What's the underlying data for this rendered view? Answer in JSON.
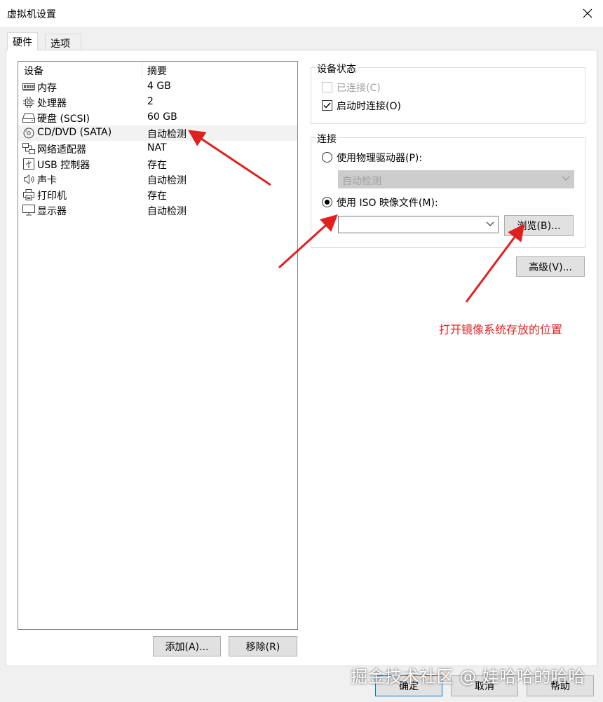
{
  "window": {
    "title": "虚拟机设置",
    "close_icon": "close-icon"
  },
  "tabs": [
    {
      "label": "硬件",
      "active": true
    },
    {
      "label": "选项",
      "active": false
    }
  ],
  "device_list": {
    "header_device": "设备",
    "header_summary": "摘要",
    "rows": [
      {
        "name": "内存",
        "summary": "4 GB",
        "icon": "memory-icon"
      },
      {
        "name": "处理器",
        "summary": "2",
        "icon": "processor-icon"
      },
      {
        "name": "硬盘 (SCSI)",
        "summary": "60 GB",
        "icon": "hard-disk-icon"
      },
      {
        "name": "CD/DVD (SATA)",
        "summary": "自动检测",
        "icon": "cd-dvd-icon",
        "selected": true
      },
      {
        "name": "网络适配器",
        "summary": "NAT",
        "icon": "network-adapter-icon"
      },
      {
        "name": "USB 控制器",
        "summary": "存在",
        "icon": "usb-controller-icon"
      },
      {
        "name": "声卡",
        "summary": "自动检测",
        "icon": "sound-card-icon"
      },
      {
        "name": "打印机",
        "summary": "存在",
        "icon": "printer-icon"
      },
      {
        "name": "显示器",
        "summary": "自动检测",
        "icon": "display-icon"
      }
    ],
    "add_button": "添加(A)...",
    "remove_button": "移除(R)"
  },
  "device_status": {
    "label": "设备状态",
    "connected": {
      "label": "已连接(C)",
      "checked": false,
      "enabled": false
    },
    "connect_at_power_on": {
      "label": "启动时连接(O)",
      "checked": true
    }
  },
  "connection": {
    "label": "连接",
    "physical_drive": {
      "label": "使用物理驱动器(P):",
      "selected": false
    },
    "physical_drive_value": "自动检测",
    "iso_image": {
      "label": "使用 ISO 映像文件(M):",
      "selected": true
    },
    "iso_path": "",
    "browse_button": "浏览(B)..."
  },
  "advanced_button": "高级(V)...",
  "annotation": "打开镜像系统存放的位置",
  "colors": {
    "annotation": "#e02020",
    "focus_border": "#0078d7"
  },
  "footer": {
    "ok_button": "确定",
    "cancel_button": "取消",
    "help_button": "帮助"
  },
  "watermark": "掘金技术社区 @ 娃哈哈的哈哈"
}
